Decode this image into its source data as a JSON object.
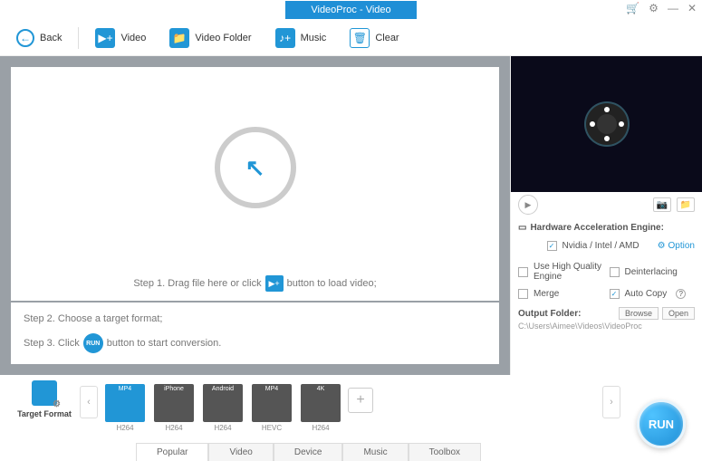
{
  "titlebar": {
    "title": "VideoProc - Video"
  },
  "toolbar": {
    "back": "Back",
    "video": "Video",
    "video_folder": "Video Folder",
    "music": "Music",
    "clear": "Clear"
  },
  "steps": {
    "step1_a": "Step 1. Drag file here or click",
    "step1_b": "button to load video;",
    "step2": "Step 2. Choose a target format;",
    "step3_a": "Step 3. Click",
    "step3_b": "button to start conversion.",
    "run_mini": "RUN"
  },
  "right": {
    "hw_title": "Hardware Acceleration Engine:",
    "vendors": "Nvidia / Intel / AMD",
    "option": "Option",
    "hq_engine": "Use High Quality Engine",
    "deinterlacing": "Deinterlacing",
    "merge": "Merge",
    "auto_copy": "Auto Copy",
    "help": "?",
    "output_label": "Output Folder:",
    "browse": "Browse",
    "open": "Open",
    "output_path": "C:\\Users\\Aimee\\Videos\\VideoProc"
  },
  "formats": {
    "target_label": "Target Format",
    "items": [
      {
        "top": "MP4",
        "sub": "H264",
        "selected": true
      },
      {
        "top": "iPhone",
        "sub": "H264",
        "selected": false
      },
      {
        "top": "Android",
        "sub": "H264",
        "selected": false
      },
      {
        "top": "MP4",
        "sub": "HEVC",
        "selected": false
      },
      {
        "top": "4K",
        "sub": "H264",
        "selected": false
      }
    ]
  },
  "tabs": [
    "Popular",
    "Video",
    "Device",
    "Music",
    "Toolbox"
  ],
  "run": "RUN"
}
